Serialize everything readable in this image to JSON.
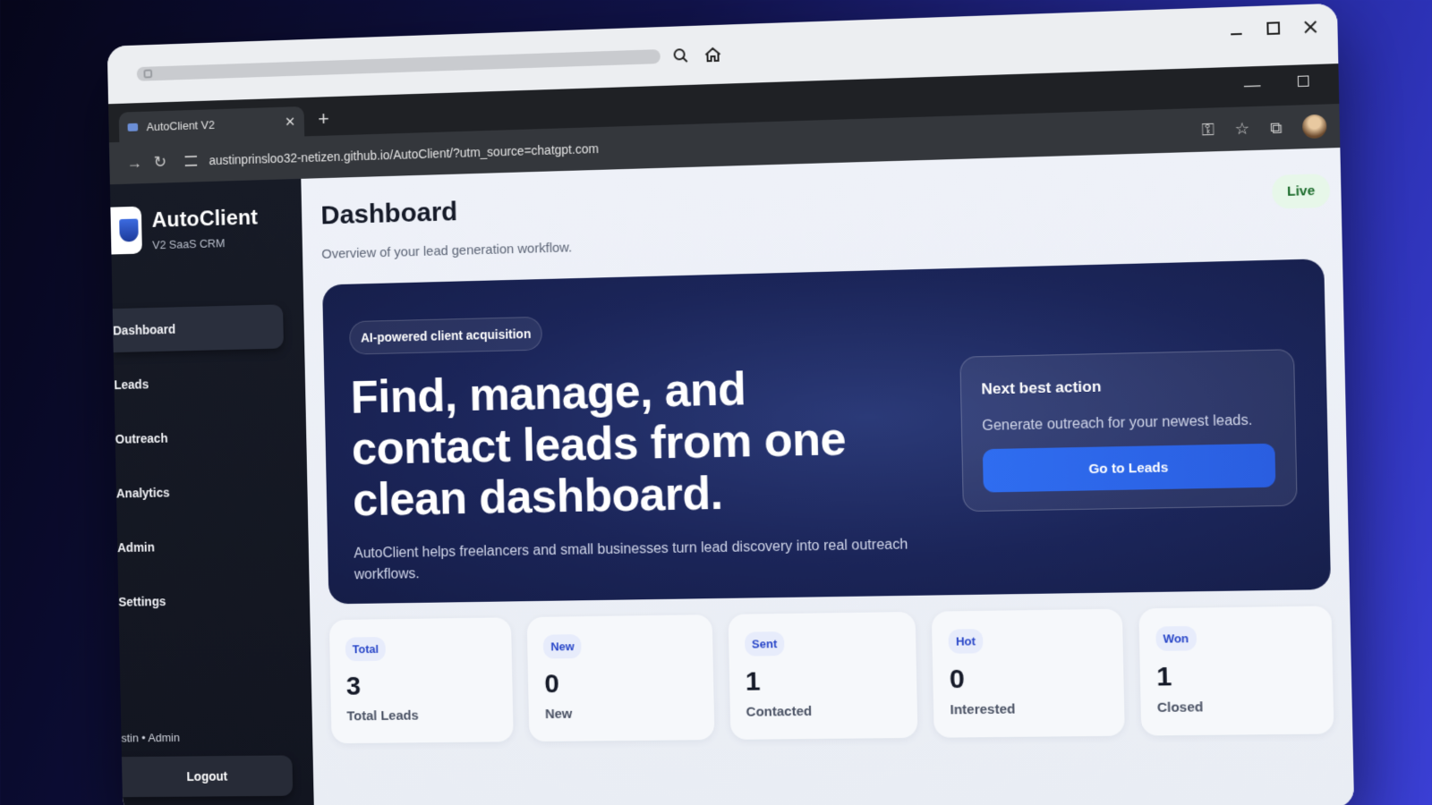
{
  "browser": {
    "tab_title": "AutoClient V2",
    "url": "austinprinsloo32-netizen.github.io/AutoClient/?utm_source=chatgpt.com"
  },
  "sidebar": {
    "brand_name": "AutoClient",
    "brand_sub": "V2 SaaS CRM",
    "items": [
      {
        "label": "Dashboard",
        "active": true
      },
      {
        "label": "Leads"
      },
      {
        "label": "Outreach"
      },
      {
        "label": "Analytics"
      },
      {
        "label": "Admin"
      },
      {
        "label": "Settings"
      }
    ],
    "user": "stin • Admin",
    "logout": "Logout"
  },
  "header": {
    "title": "Dashboard",
    "subtitle": "Overview of your lead generation workflow.",
    "status": "Live"
  },
  "hero": {
    "pill": "AI-powered client acquisition",
    "title": "Find, manage, and contact leads from one clean dashboard.",
    "description": "AutoClient helps freelancers and small businesses turn lead discovery into real outreach workflows.",
    "next_action": {
      "title": "Next best action",
      "text": "Generate outreach for your newest leads.",
      "button": "Go to Leads"
    }
  },
  "stats": [
    {
      "badge": "Total",
      "value": "3",
      "label": "Total Leads"
    },
    {
      "badge": "New",
      "value": "0",
      "label": "New"
    },
    {
      "badge": "Sent",
      "value": "1",
      "label": "Contacted"
    },
    {
      "badge": "Hot",
      "value": "0",
      "label": "Interested"
    },
    {
      "badge": "Won",
      "value": "1",
      "label": "Closed"
    }
  ],
  "colors": {
    "accent": "#2f6df0",
    "sidebar": "#171b26",
    "hero": "#1b2559",
    "live_bg": "#e7f7e9"
  }
}
